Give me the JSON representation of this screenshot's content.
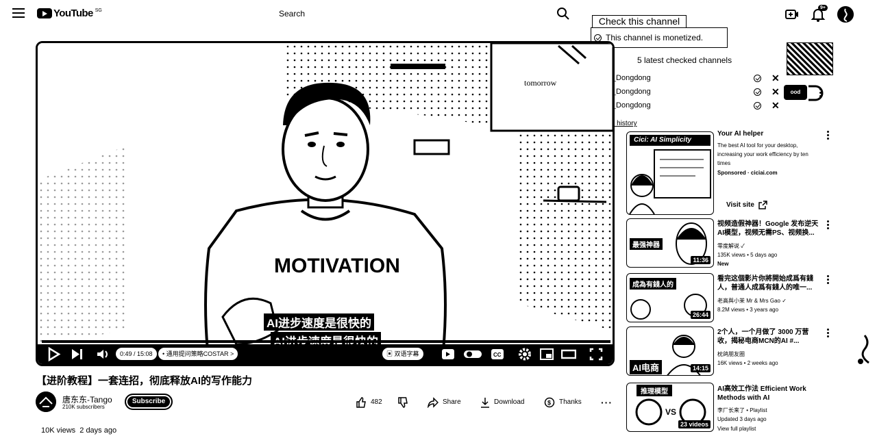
{
  "masthead": {
    "logo_text": "YouTube",
    "country_code": "SG",
    "search_placeholder": "Search",
    "notification_count": "9+"
  },
  "extension": {
    "check_button": "Check this channel",
    "monetized_text": "This channel is monetized.",
    "latest_title": "5 latest checked channels",
    "channels": [
      {
        "name": "@Tan_Dongdong"
      },
      {
        "name": "@Tan_Dongdong"
      },
      {
        "name": "@Tan_Dongdong"
      }
    ],
    "full_history": "See full history"
  },
  "player": {
    "subtitle_line1": "AI进步速度是很快的",
    "subtitle_line2": "AI进步速度是很快的",
    "time": "0:49 / 15:08",
    "chapter": "• 通用提问策略COSTAR >",
    "caption_lang": "双语字幕",
    "progress": 0.054,
    "shirt_text": "MOTIVATION",
    "wall_text": "tomorrow"
  },
  "video": {
    "title": "【进阶教程】一套连招，彻底释放AI的写作能力",
    "channel_name": "唐东东-Tango",
    "subscribers": "210K subscribers",
    "subscribe_label": "Subscribe",
    "likes": "482",
    "share_label": "Share",
    "download_label": "Download",
    "thanks_label": "Thanks",
    "views": "10K views",
    "age": "2 days ago"
  },
  "sidebar": {
    "ad_badge": "ood",
    "sponsored": {
      "title": "Your AI helper",
      "description": "The best AI tool for your desktop, increasing your work efficiency by ten times",
      "sponsor": "Sponsored · ciciai.com",
      "visit": "Visit site",
      "thumb_text": "Cici: AI Simplicity"
    },
    "recommendations": [
      {
        "title": "视频造假神器！Google 发布逆天AI模型，视频无需PS、视频换...",
        "channel": "零度解说 ✓",
        "meta": "135K views • 5 days ago",
        "badge": "New",
        "duration": "11:36",
        "thumb_text": "最强神器"
      },
      {
        "title": "看完这個影片你將開始成爲有錢人，普通人成爲有錢人的唯一...",
        "channel": "老高與小茉 Mr & Mrs Gao ✓",
        "meta": "8.2M views • 3 years ago",
        "duration": "26:44",
        "thumb_text": "成為有錢人的"
      },
      {
        "title": "2个人，一个月做了 3000 万营收，揭秘电商MCN的AI #...",
        "channel": "枕鸽朋友圈",
        "meta": "16K views • 2 weeks ago",
        "duration": "14:15",
        "thumb_text": "AI电商"
      },
      {
        "title": "AI高效工作法 Efficient Work Methods with AI",
        "channel": "李厂长来了 • Playlist",
        "meta": "Updated 3 days ago",
        "badge": "View full playlist",
        "duration": "23 videos",
        "thumb_text": "推理模型"
      }
    ]
  }
}
